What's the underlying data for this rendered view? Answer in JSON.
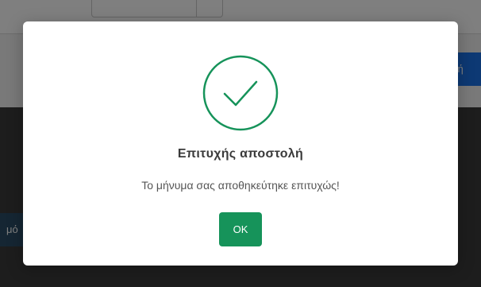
{
  "background": {
    "send_button_label": "λή",
    "side_button_label": "μό"
  },
  "dialog": {
    "icon": "check-circle-icon",
    "title": "Επιτυχής αποστολή",
    "message": "Το μήνυμα σας αποθηκεύτηκε επιτυχώς!",
    "ok_label": "OK"
  },
  "colors": {
    "success": "#16935a",
    "primary": "#1a73e8",
    "overlay": "rgba(0,0,0,0.5)"
  }
}
